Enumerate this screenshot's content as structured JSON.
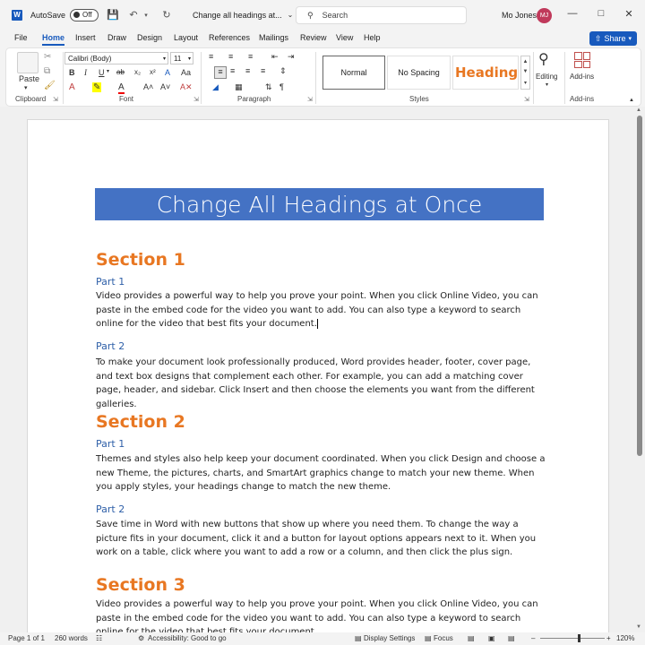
{
  "titlebar": {
    "autosave_label": "AutoSave",
    "autosave_state": "Off",
    "doc_title": "Change all headings at...",
    "search_placeholder": "Search",
    "user_name": "Mo Jones",
    "user_initials": "MJ"
  },
  "menu": {
    "tabs": [
      "File",
      "Home",
      "Insert",
      "Draw",
      "Design",
      "Layout",
      "References",
      "Mailings",
      "Review",
      "View",
      "Help"
    ],
    "active": "Home",
    "share_label": "Share"
  },
  "ribbon": {
    "clipboard": {
      "label": "Clipboard",
      "paste_label": "Paste"
    },
    "font": {
      "label": "Font",
      "font_name": "Calibri (Body)",
      "font_size": "11"
    },
    "paragraph": {
      "label": "Paragraph"
    },
    "styles": {
      "label": "Styles",
      "items": [
        "Normal",
        "No Spacing",
        "Heading"
      ]
    },
    "editing": {
      "label": "Editing"
    },
    "addins": {
      "label": "Add-ins",
      "group_label": "Add-ins"
    }
  },
  "document": {
    "title": "Change All Headings at Once",
    "sections": [
      {
        "heading": "Section 1"
      },
      {
        "heading": "Section 2"
      },
      {
        "heading": "Section 3"
      }
    ],
    "parts": {
      "s1p1": "Part 1",
      "s1p2": "Part 2",
      "s2p1": "Part 1",
      "s2p2": "Part 2"
    },
    "paragraphs": {
      "s1p1": "Video provides a powerful way to help you prove your point. When you click Online Video, you can paste in the embed code for the video you want to add. You can also type a keyword to search online for the video that best fits your document.",
      "s1p2": "To make your document look professionally produced, Word provides header, footer, cover page, and text box designs that complement each other. For example, you can add a matching cover page, header, and sidebar. Click Insert and then choose the elements you want from the different galleries.",
      "s2p1": "Themes and styles also help keep your document coordinated. When you click Design and choose a new Theme, the pictures, charts, and SmartArt graphics change to match your new theme. When you apply styles, your headings change to match the new theme.",
      "s2p2": "Save time in Word with new buttons that show up where you need them. To change the way a picture fits in your document, click it and a button for layout options appears next to it. When you work on a table, click where you want to add a row or a column, and then click the plus sign.",
      "s3": "Video provides a powerful way to help you prove your point. When you click Online Video, you can paste in the embed code for the video you want to add. You can also type a keyword to search online for the video that best fits your document."
    }
  },
  "status": {
    "page": "Page 1 of 1",
    "words": "260 words",
    "accessibility": "Accessibility: Good to go",
    "display_settings": "Display Settings",
    "focus": "Focus",
    "zoom": "120%"
  },
  "colors": {
    "accent": "#185abd",
    "banner": "#4472c4",
    "section": "#e87722",
    "part": "#2e5fa8"
  }
}
